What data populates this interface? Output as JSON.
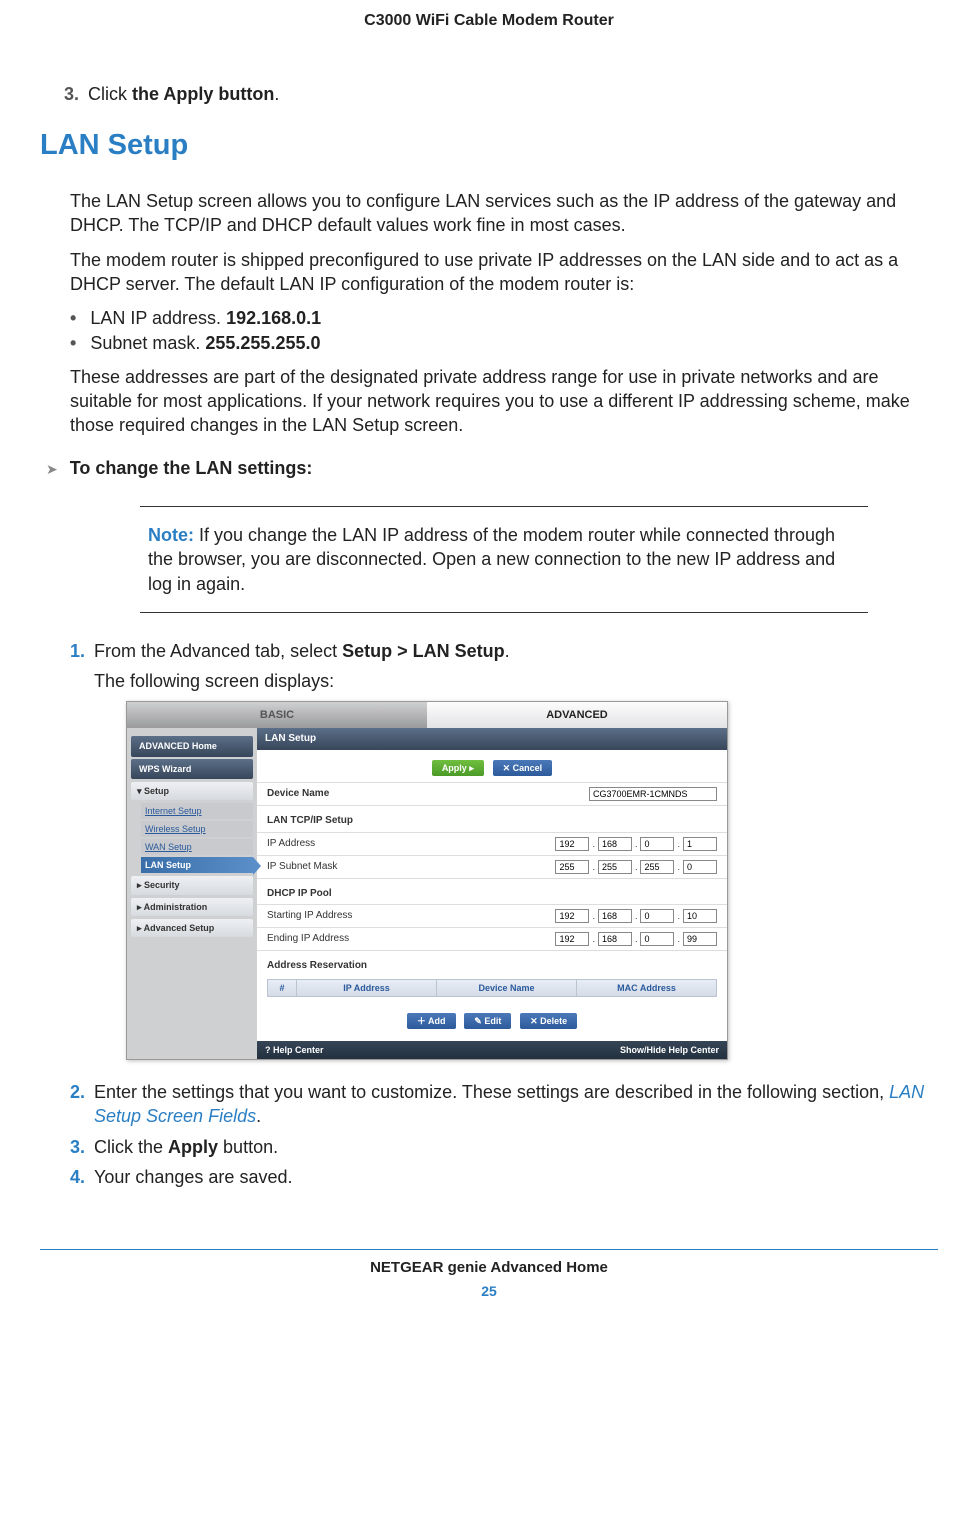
{
  "header": "C3000 WiFi Cable Modem Router",
  "step3_num": "3.",
  "step3_a": "Click ",
  "step3_b": "the Apply button",
  "step3_c": ".",
  "heading": "LAN Setup",
  "p1": "The LAN Setup screen allows you to configure LAN services such as the IP address of the gateway and DHCP. The TCP/IP and DHCP default values work fine in most cases.",
  "p2": "The modem router is shipped preconfigured to use private IP addresses on the LAN side and to act as a DHCP server. The default LAN IP configuration of the modem router is:",
  "b1a": "LAN IP address. ",
  "b1b": "192.168.0.1",
  "b2a": "Subnet mask. ",
  "b2b": "255.255.255.0",
  "p3": "These addresses are part of the designated private address range for use in private networks and are suitable for most applications. If your network requires you to use a different IP addressing scheme, make those required changes in the LAN Setup screen.",
  "task": "To change the LAN settings:",
  "note_label": "Note:",
  "note_text": " If you change the LAN IP address of the modem router while connected through the browser, you are disconnected. Open a new connection to the new IP address and log in again.",
  "ol1_num": "1.",
  "ol1a": "From the Advanced tab, select ",
  "ol1b": "Setup > LAN Setup",
  "ol1c": ".",
  "ol1_sub": "The following screen displays:",
  "ol2_num": "2.",
  "ol2a": "Enter the settings that you want to customize. These settings are described in the following section, ",
  "ol2_link": "LAN Setup Screen Fields",
  "ol2c": ".",
  "ol3_num": "3.",
  "ol3a": "Click the ",
  "ol3b": "Apply",
  "ol3c": " button.",
  "ol4_num": "4.",
  "ol4": "Your changes are saved.",
  "footer": "NETGEAR genie Advanced Home",
  "page_num": "25",
  "shot": {
    "tab_basic": "BASIC",
    "tab_adv": "ADVANCED",
    "side": {
      "adv_home": "ADVANCED Home",
      "wps": "WPS Wizard",
      "setup": "▾ Setup",
      "internet": "Internet Setup",
      "wireless": "Wireless Setup",
      "wan": "WAN Setup",
      "lan": "LAN Setup",
      "security": "▸ Security",
      "admin": "▸ Administration",
      "advsetup": "▸ Advanced Setup"
    },
    "title": "LAN Setup",
    "apply": "Apply ▸",
    "cancel": "✕ Cancel",
    "device_name_lbl": "Device Name",
    "device_name_val": "CG3700EMR-1CMNDS",
    "tcpip": "LAN TCP/IP Setup",
    "ip_lbl": "IP Address",
    "ip": [
      "192",
      "168",
      "0",
      "1"
    ],
    "mask_lbl": "IP Subnet Mask",
    "mask": [
      "255",
      "255",
      "255",
      "0"
    ],
    "dhcp": "DHCP IP Pool",
    "start_lbl": "Starting IP Address",
    "start": [
      "192",
      "168",
      "0",
      "10"
    ],
    "end_lbl": "Ending IP Address",
    "end": [
      "192",
      "168",
      "0",
      "99"
    ],
    "addr_res": "Address Reservation",
    "th_num": "#",
    "th_ip": "IP Address",
    "th_dev": "Device Name",
    "th_mac": "MAC Address",
    "add": "＋ Add",
    "edit": "✎ Edit",
    "del": "✕ Delete",
    "help_l": "? Help Center",
    "help_r": "Show/Hide Help Center"
  }
}
